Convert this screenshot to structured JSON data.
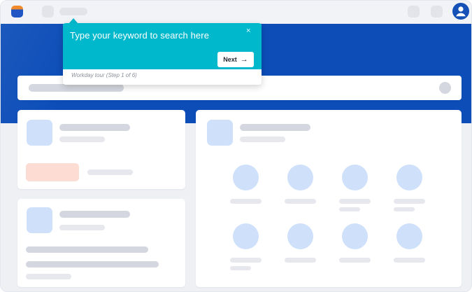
{
  "tooltip": {
    "message": "Type your keyword to search here",
    "close_icon": "×",
    "next_label": "Next",
    "next_arrow": "→",
    "footer": "Workday tour (Step 1 of 6)"
  },
  "icons": {
    "app_logo": "app-logo-icon",
    "avatar": "user-avatar-icon",
    "close": "close-icon",
    "arrow": "arrow-right-icon"
  },
  "colors": {
    "primary_blue": "#0c4db8",
    "tooltip_teal": "#00b8cc",
    "placeholder_gray": "#d4d7df",
    "placeholder_blue": "#cfe0fb",
    "placeholder_salmon": "#fcdcd3"
  }
}
